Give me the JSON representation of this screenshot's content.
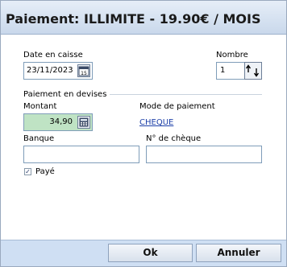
{
  "title": "Paiement: ILLIMITE - 19.90€ / MOIS",
  "date_label": "Date en caisse",
  "date_value": "23/11/2023",
  "nombre_label": "Nombre",
  "nombre_value": "1",
  "section_label": "Paiement en devises",
  "montant_label": "Montant",
  "montant_value": "34,90",
  "mode_label": "Mode de paiement",
  "mode_value": "CHEQUE",
  "banque_label": "Banque",
  "banque_value": "",
  "cheque_label": "N° de chèque",
  "cheque_value": "",
  "paye_label": "Payé",
  "paye_checked": true,
  "ok_label": "Ok",
  "annuler_label": "Annuler",
  "colors": {
    "montant_bg": "#bfe3c4",
    "title_bg": "#d6e3f2",
    "footer_bg": "#cfdff3",
    "link": "#1c3fa8"
  }
}
